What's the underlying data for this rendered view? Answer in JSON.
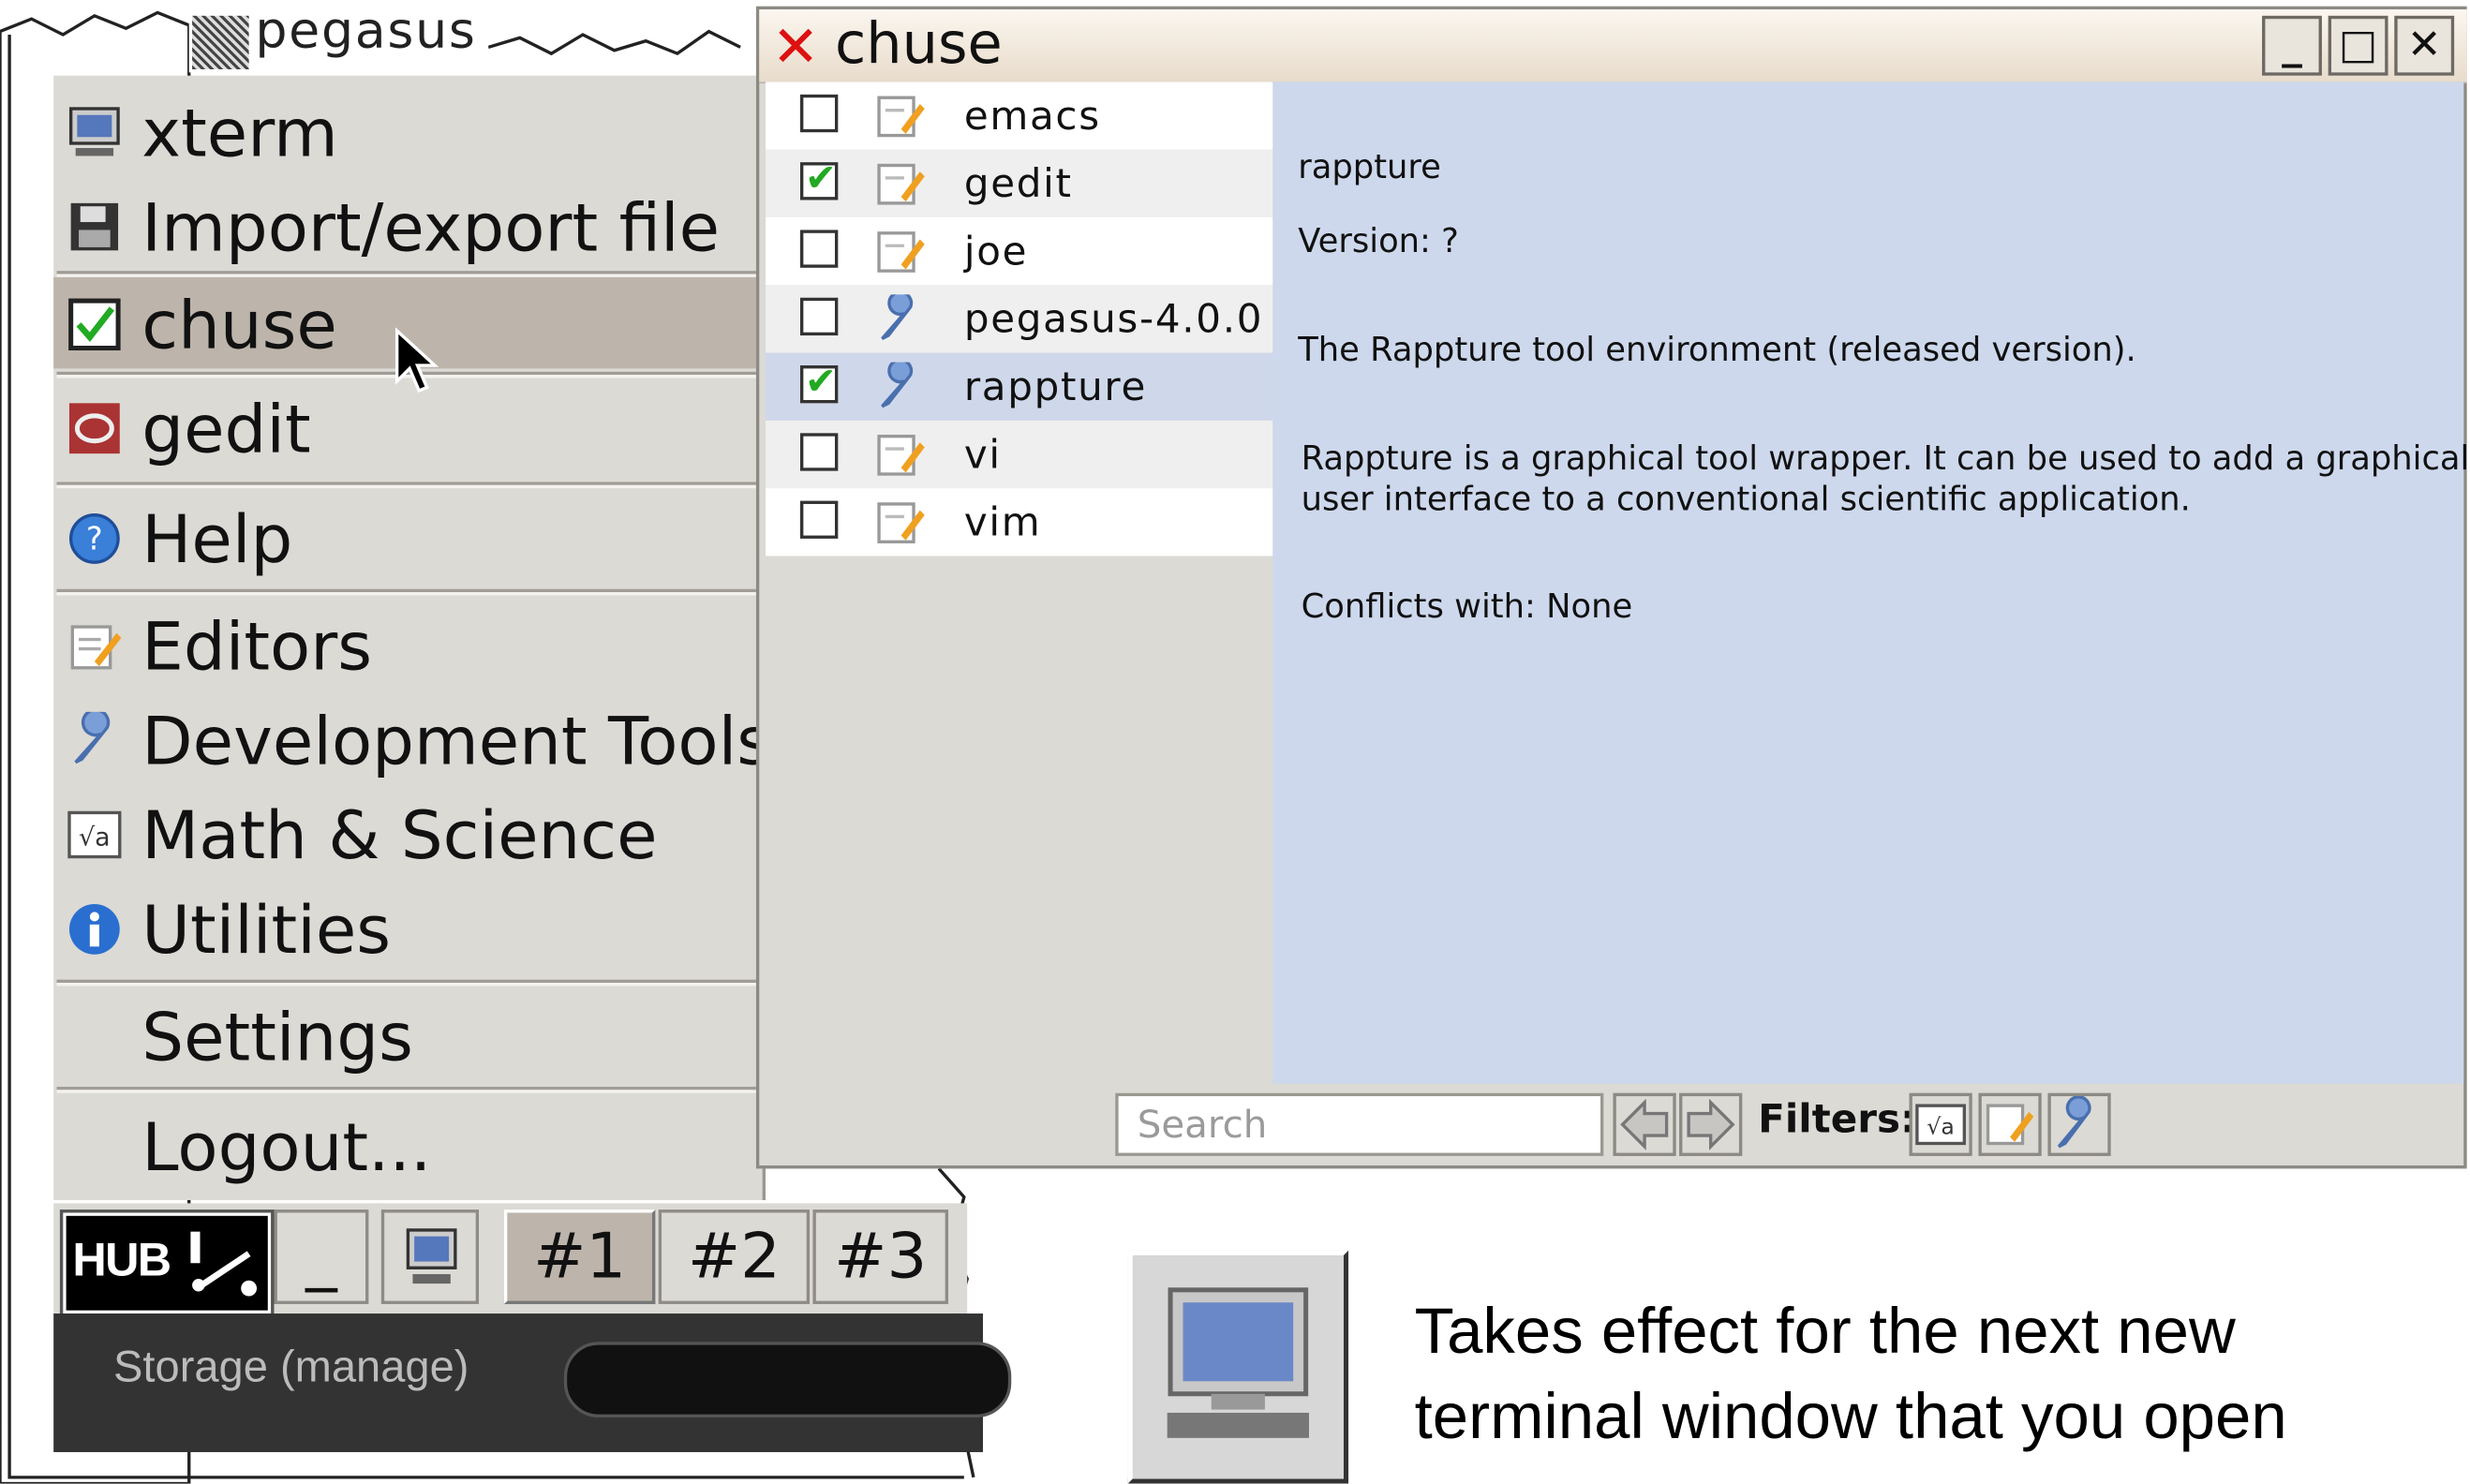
{
  "menu": {
    "window_title_fragment": "pegasus",
    "items": [
      {
        "label": "xterm",
        "icon": "terminal-icon"
      },
      {
        "label": "Import/export file",
        "icon": "floppy-icon"
      },
      {
        "label": "chuse",
        "icon": "checkbox-icon"
      },
      {
        "label": "gedit",
        "icon": "gedit-icon"
      },
      {
        "label": "Help",
        "icon": "help-icon"
      },
      {
        "label": "Editors",
        "icon": "editor-icon"
      },
      {
        "label": "Development Tools",
        "icon": "wrench-icon"
      },
      {
        "label": "Math & Science",
        "icon": "math-icon"
      },
      {
        "label": "Utilities",
        "icon": "info-icon"
      },
      {
        "label": "Settings",
        "icon": ""
      },
      {
        "label": "Logout...",
        "icon": ""
      }
    ]
  },
  "taskbar": {
    "hub_label": "HUB",
    "minimize_label": "_",
    "workspaces": [
      "#1",
      "#2",
      "#3"
    ],
    "storage_label": "Storage (manage)"
  },
  "chuse": {
    "title": "chuse",
    "close_mark": "✕",
    "controls": {
      "minimize": "_",
      "maximize": "□",
      "close": "✕"
    },
    "packages": [
      {
        "name": "emacs",
        "checked": false,
        "icon": "editor-icon"
      },
      {
        "name": "gedit",
        "checked": true,
        "icon": "editor-icon"
      },
      {
        "name": "joe",
        "checked": false,
        "icon": "editor-icon"
      },
      {
        "name": "pegasus-4.0.0",
        "checked": false,
        "icon": "wrench-icon"
      },
      {
        "name": "rappture",
        "checked": true,
        "icon": "wrench-icon"
      },
      {
        "name": "vi",
        "checked": false,
        "icon": "editor-icon"
      },
      {
        "name": "vim",
        "checked": false,
        "icon": "editor-icon"
      }
    ],
    "detail": {
      "name": "rappture",
      "version": "Version: ?",
      "summary": "The Rappture tool environment (released version).",
      "description_1": "Rappture is a graphical tool wrapper. It can be used to add a graphical",
      "description_2": "user interface to a conventional scientific application.",
      "conflicts": "Conflicts with: None"
    },
    "search_placeholder": "Search",
    "filters_label": "Filters:"
  },
  "hint": {
    "line1": "Takes effect for the next new",
    "line2": "terminal window that you open"
  }
}
